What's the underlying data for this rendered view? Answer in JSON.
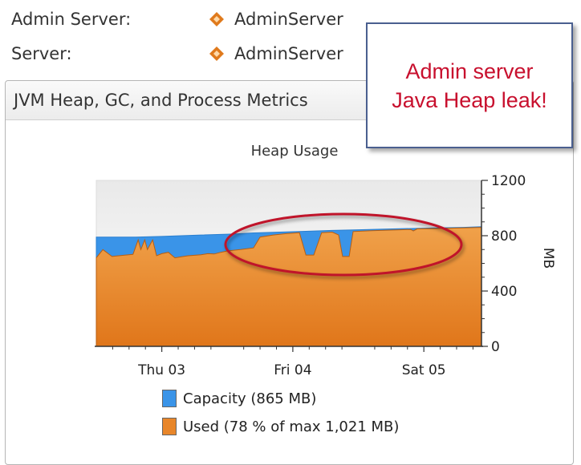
{
  "server_info": [
    {
      "label": "Admin Server:",
      "value": "AdminServer"
    },
    {
      "label": "Server:",
      "value": "AdminServer"
    }
  ],
  "panel": {
    "title": "JVM Heap, GC, and Process Metrics"
  },
  "callout": {
    "line1": "Admin server",
    "line2": "Java Heap leak!"
  },
  "colors": {
    "capacity": "#3a94e8",
    "used": "#e8862a",
    "callout_text": "#c8102e",
    "highlight_ellipse": "#c0142a",
    "server_icon": "#e07a1c"
  },
  "icons": {
    "server": "diamond-server-icon"
  },
  "chart_data": {
    "type": "area",
    "title": "Heap Usage",
    "ylabel": "MB",
    "ylim": [
      0,
      1200
    ],
    "yticks": [
      0,
      400,
      800,
      1200
    ],
    "x_ticks": [
      "Thu 03",
      "Fri 04",
      "Sat 05"
    ],
    "x_tick_positions_in_days": [
      0.5,
      1.5,
      2.5
    ],
    "xlim_days": [
      0,
      2.94
    ],
    "series": [
      {
        "name": "Capacity (865 MB)",
        "points": [
          [
            0.0,
            790
          ],
          [
            0.3,
            790
          ],
          [
            0.5,
            795
          ],
          [
            0.8,
            805
          ],
          [
            1.05,
            812
          ],
          [
            1.2,
            820
          ],
          [
            1.4,
            826
          ],
          [
            1.6,
            832
          ],
          [
            1.8,
            838
          ],
          [
            2.0,
            843
          ],
          [
            2.2,
            848
          ],
          [
            2.4,
            852
          ],
          [
            2.6,
            856
          ],
          [
            2.8,
            860
          ],
          [
            2.94,
            865
          ]
        ]
      },
      {
        "name": "Used (78 % of max 1,021 MB)",
        "points": [
          [
            0.0,
            640
          ],
          [
            0.05,
            700
          ],
          [
            0.12,
            650
          ],
          [
            0.2,
            658
          ],
          [
            0.28,
            665
          ],
          [
            0.32,
            770
          ],
          [
            0.34,
            700
          ],
          [
            0.37,
            770
          ],
          [
            0.39,
            700
          ],
          [
            0.43,
            770
          ],
          [
            0.46,
            655
          ],
          [
            0.5,
            670
          ],
          [
            0.55,
            680
          ],
          [
            0.6,
            640
          ],
          [
            0.65,
            648
          ],
          [
            0.7,
            655
          ],
          [
            0.8,
            662
          ],
          [
            0.85,
            670
          ],
          [
            0.9,
            668
          ],
          [
            0.95,
            680
          ],
          [
            1.0,
            690
          ],
          [
            1.1,
            700
          ],
          [
            1.2,
            712
          ],
          [
            1.25,
            790
          ],
          [
            1.35,
            805
          ],
          [
            1.45,
            815
          ],
          [
            1.55,
            822
          ],
          [
            1.6,
            660
          ],
          [
            1.66,
            660
          ],
          [
            1.72,
            822
          ],
          [
            1.8,
            826
          ],
          [
            1.85,
            805
          ],
          [
            1.88,
            650
          ],
          [
            1.93,
            650
          ],
          [
            1.96,
            830
          ],
          [
            2.1,
            836
          ],
          [
            2.3,
            842
          ],
          [
            2.4,
            845
          ],
          [
            2.42,
            835
          ],
          [
            2.45,
            850
          ],
          [
            2.6,
            852
          ],
          [
            2.8,
            856
          ],
          [
            2.94,
            860
          ]
        ]
      }
    ],
    "annotation": "highlight ellipse around Fri 04 – Sat 05 heap growth"
  }
}
